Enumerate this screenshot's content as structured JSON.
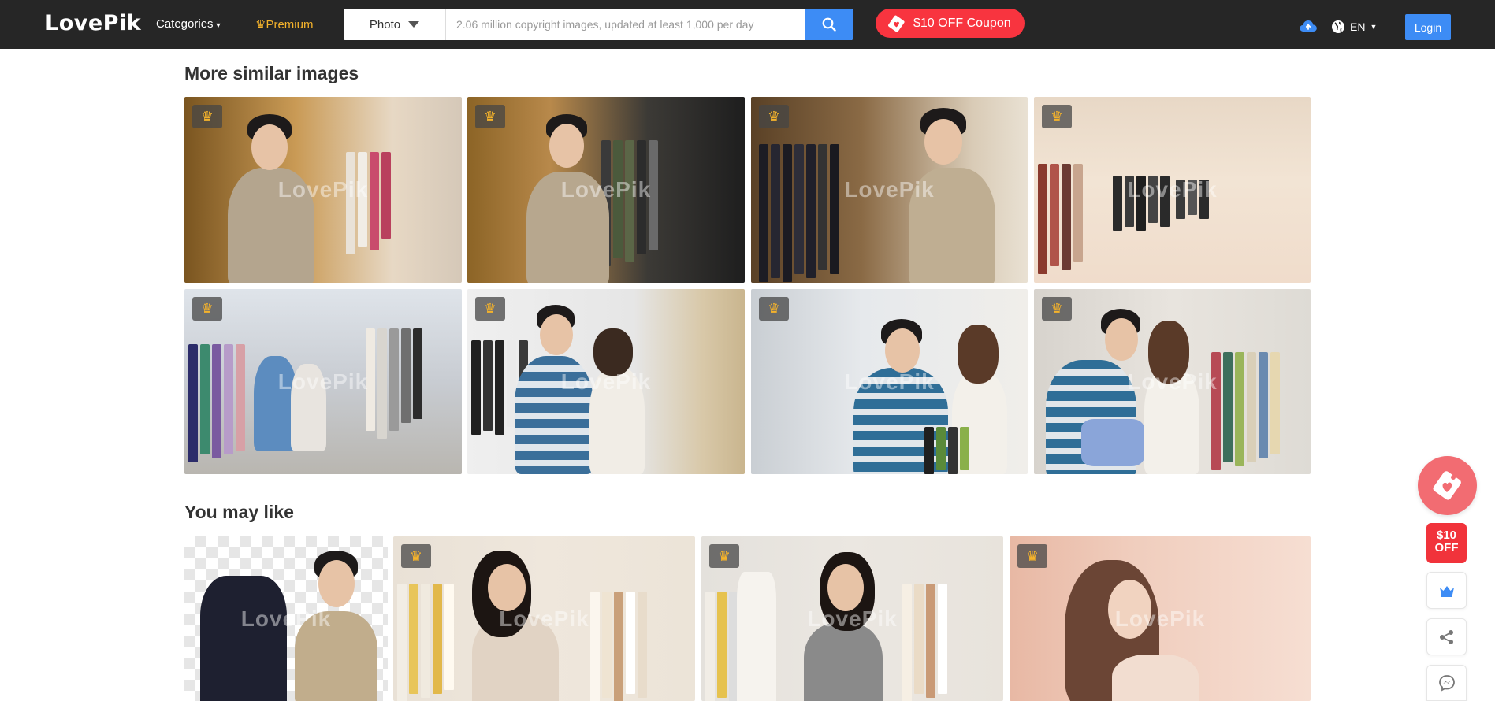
{
  "header": {
    "logo": "LovePik",
    "categories_label": "Categories",
    "premium_label": "Premium",
    "search_type": "Photo",
    "search_placeholder": "2.06 million copyright images, updated at least 1,000 per day",
    "coupon_label": "$10 OFF Coupon",
    "language": "EN",
    "login_label": "Login"
  },
  "similar": {
    "title": "More similar images",
    "watermark": "LovePik"
  },
  "may_like": {
    "title": "You may like",
    "watermark": "LovePik"
  },
  "side": {
    "off_line1": "$10",
    "off_line2": "OFF"
  },
  "colors": {
    "header_bg": "#262626",
    "accent_blue": "#3d8cf5",
    "coupon_red": "#f8343f",
    "premium_gold": "#f5b32b"
  }
}
